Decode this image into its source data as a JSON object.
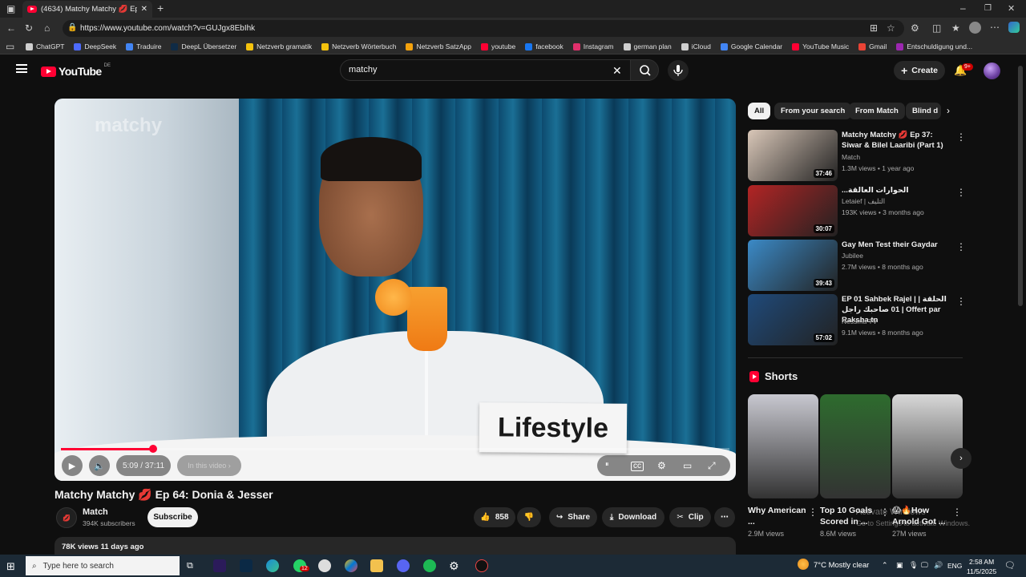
{
  "browser": {
    "tab_title": "(4634) Matchy Matchy 💋 Ep",
    "url": "https://www.youtube.com/watch?v=GUJgx8EbIhk",
    "bookmarks": [
      {
        "label": "ChatGPT",
        "color": "#cfcfcf"
      },
      {
        "label": "DeepSeek",
        "color": "#4d6bfe"
      },
      {
        "label": "Traduire",
        "color": "#4285f4"
      },
      {
        "label": "DeepL Übersetzer",
        "color": "#0f2b46"
      },
      {
        "label": "Netzverb gramatik",
        "color": "#f4c20d"
      },
      {
        "label": "Netzverb Wörterbuch",
        "color": "#f4c20d"
      },
      {
        "label": "Netzverb SatzApp",
        "color": "#f4a20d"
      },
      {
        "label": "youtube",
        "color": "#ff0033"
      },
      {
        "label": "facebook",
        "color": "#1877f2"
      },
      {
        "label": "Instagram",
        "color": "#e1306c"
      },
      {
        "label": "german plan",
        "color": "#cfcfcf"
      },
      {
        "label": "iCloud",
        "color": "#cfcfcf"
      },
      {
        "label": "Google Calendar",
        "color": "#4285f4"
      },
      {
        "label": "YouTube Music",
        "color": "#ff0033"
      },
      {
        "label": "Gmail",
        "color": "#ea4335"
      },
      {
        "label": "Entschuldigung und...",
        "color": "#9c27b0"
      }
    ]
  },
  "header": {
    "logo_text": "YouTube",
    "country": "DE",
    "search_value": "matchy",
    "create_label": "Create",
    "notifications": "9+"
  },
  "player": {
    "overlay_logo": "matchy",
    "sign_text": "Lifestyle",
    "time": "5:09 / 37:11",
    "in_video": "In this video ›",
    "progress": 0.138
  },
  "video": {
    "title": "Matchy Matchy 💋 Ep 64: Donia & Jesser",
    "channel": "Match",
    "subscribers": "394K subscribers",
    "subscribe_label": "Subscribe",
    "likes": "858",
    "share_label": "Share",
    "download_label": "Download",
    "clip_label": "Clip",
    "views_date": "78K views  11 days ago"
  },
  "chips": [
    "All",
    "From your search",
    "From Match",
    "Blind d"
  ],
  "recommendations": [
    {
      "title": "Matchy Matchy 💋 Ep 37: Siwar & Bilel Laaribi (Part 1)",
      "channel": "Match",
      "meta": "1.3M views • 1 year ago",
      "duration": "37:46",
      "thumb": "#d9c7b8"
    },
    {
      "title": "...الحوارات العالقة",
      "channel": "Letaief | التليف",
      "meta": "193K views • 3 months ago",
      "duration": "30:07",
      "thumb": "#b32424"
    },
    {
      "title": "Gay Men Test their Gaydar",
      "channel": "Jubilee",
      "meta": "2.7M views • 8 months ago",
      "duration": "39:43",
      "thumb": "#3b8ac7"
    },
    {
      "title": "EP 01 Sahbek Rajel | | الحلقة 01 صاحبك راجل | Offert par Raksha.tn",
      "channel": "Nessma TV",
      "meta": "9.1M views • 8 months ago",
      "duration": "57:02",
      "thumb": "#1f4a7a"
    }
  ],
  "shorts": {
    "heading": "Shorts",
    "items": [
      {
        "title": "Why American ...",
        "views": "2.9M views",
        "thumb": "#c8c8d0"
      },
      {
        "title": "Top 10 Goals Scored in ...",
        "views": "8.6M views",
        "thumb": "#2e6b2e"
      },
      {
        "title": "😱🔥How Arnold Got ...",
        "views": "27M views",
        "thumb": "#d8d8d8"
      }
    ]
  },
  "watermark": {
    "line1": "Activate Windows",
    "line2": "Go to Settings to activate Windows."
  },
  "taskbar": {
    "search_placeholder": "Type here to search",
    "weather": "7°C  Mostly clear",
    "lang": "ENG",
    "time": "2:58 AM",
    "date": "11/5/2025",
    "whatsapp_badge": "12"
  }
}
